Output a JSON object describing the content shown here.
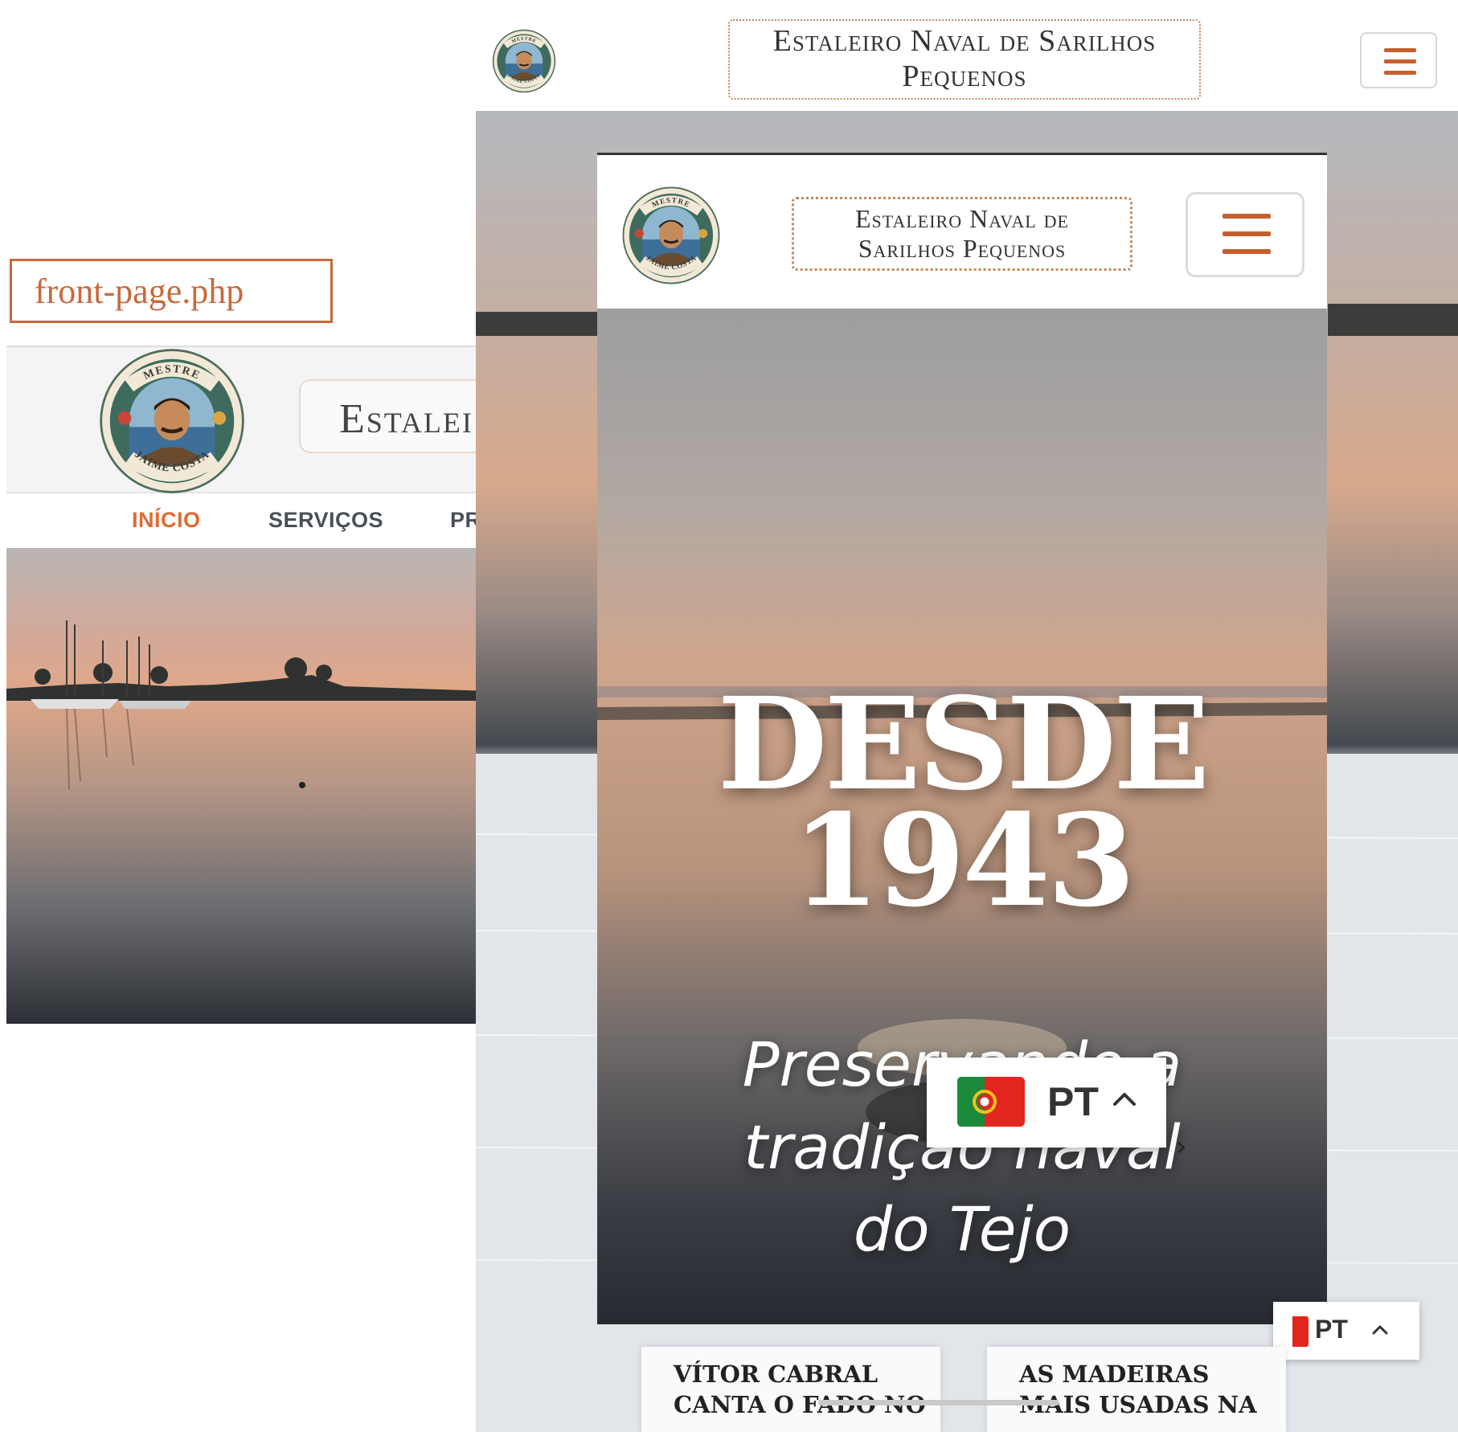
{
  "file_label": "front-page.php",
  "site": {
    "title": "Estaleiro Naval de Sarilhos Pequenos",
    "title_line1_wide": "Estaleiro Naval de Sarilhos",
    "title_line2_wide": "Pequenos",
    "title_line1_narrow": "Estaleiro Naval de",
    "title_line2_narrow": "Sarilhos Pequenos",
    "title_cropped": "Estalei",
    "logo_top_text": "MESTRE",
    "logo_bottom_text": "JAIME COSTA"
  },
  "desktop_nav": {
    "items": [
      {
        "label": "INÍCIO",
        "active": true
      },
      {
        "label": "SERVIÇOS",
        "active": false
      },
      {
        "label": "PR",
        "active": false
      }
    ]
  },
  "hero": {
    "heading_line1": "DESDE",
    "heading_line2": "1943",
    "subtitle_line1": "Preservando a",
    "subtitle_line2": "tradição naval",
    "subtitle_line3": "do Tejo",
    "next_glyph": "›"
  },
  "language": {
    "code": "PT"
  },
  "cards": [
    {
      "title": "VÍTOR CABRAL CANTA O FADO NO"
    },
    {
      "title": "AS MADEIRAS MAIS USADAS NA"
    }
  ],
  "colors": {
    "accent": "#c4602e",
    "nav_active": "#e06a35",
    "nav_text": "#4a4f57",
    "title_border": "#c48a5c"
  }
}
